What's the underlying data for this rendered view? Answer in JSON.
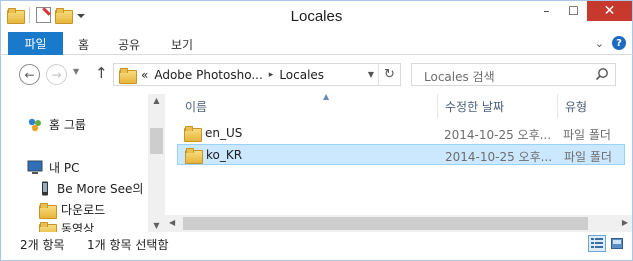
{
  "window": {
    "title": "Locales",
    "minimize": "–",
    "maximize": "☐",
    "close": "✕"
  },
  "ribbon": {
    "file_tab": "파일",
    "tabs": [
      "홈",
      "공유",
      "보기"
    ]
  },
  "navbar": {
    "back": "←",
    "forward": "→",
    "up": "↑",
    "address": {
      "overflow": "«",
      "crumbs": [
        "Adobe Photosho...",
        "Locales"
      ],
      "separator": "▸"
    },
    "search_placeholder": "Locales 검색"
  },
  "navpane": {
    "items": [
      {
        "label": "홈 그룹",
        "icon": "homegroup-icon"
      },
      {
        "label": "내 PC",
        "icon": "computer-icon"
      },
      {
        "label": "Be More See의 G",
        "icon": "phone-icon"
      },
      {
        "label": "다운로드",
        "icon": "downloads-folder-icon"
      },
      {
        "label": "동영상",
        "icon": "videos-folder-icon"
      }
    ]
  },
  "filelist": {
    "columns": {
      "name": "이름",
      "date": "수정한 날짜",
      "type": "유형"
    },
    "rows": [
      {
        "name": "en_US",
        "date": "2014-10-25 오후...",
        "type": "파일 폴더",
        "selected": false
      },
      {
        "name": "ko_KR",
        "date": "2014-10-25 오후...",
        "type": "파일 폴더",
        "selected": true
      }
    ]
  },
  "status": {
    "count": "2개 항목",
    "selection": "1개 항목 선택함"
  },
  "colors": {
    "accent": "#1979ca",
    "close": "#c7392c",
    "selection": "#cce8ff",
    "selection_border": "#99d1ff",
    "window_border": "#a8c7ea"
  }
}
